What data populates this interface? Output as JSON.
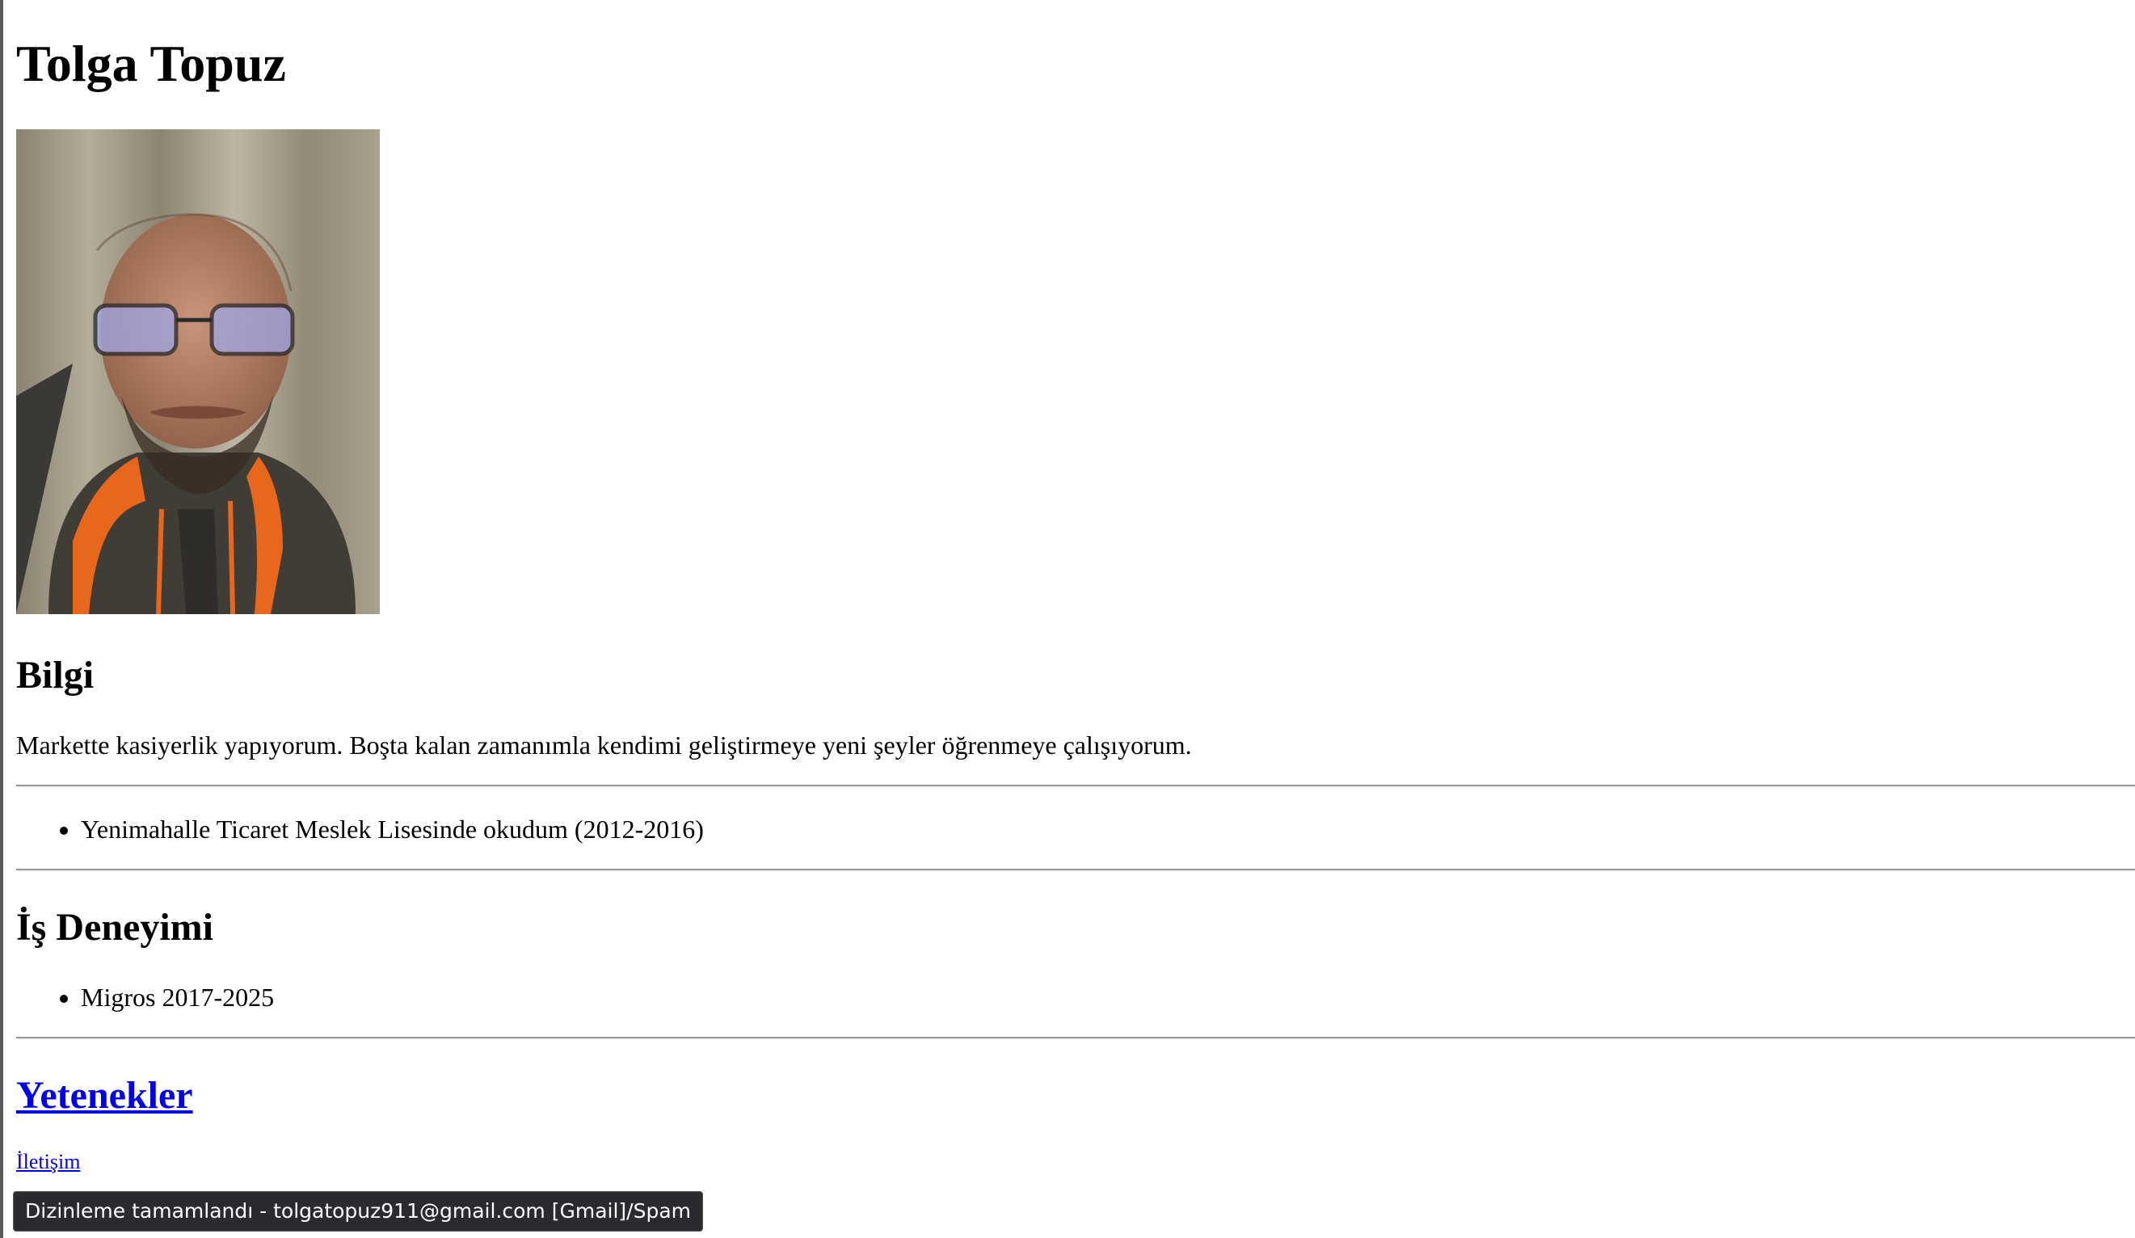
{
  "header": {
    "name": "Tolga Topuz"
  },
  "profile": {
    "photo_icon": "portrait-photo"
  },
  "about": {
    "heading": "Bilgi",
    "text": "Markette kasiyerlik yapıyorum. Boşta kalan zamanımla kendimi geliştirmeye yeni şeyler öğrenmeye çalışıyorum."
  },
  "education": {
    "items": [
      "Yenimahalle Ticaret Meslek Lisesinde okudum (2012-2016)"
    ]
  },
  "experience": {
    "heading": "İş Deneyimi",
    "items": [
      "Migros 2017-2025"
    ]
  },
  "skills": {
    "heading_link": "Yetenekler"
  },
  "contact": {
    "link": "İletişim"
  },
  "status_tooltip": {
    "text": "Dizinleme tamamlandı - tolgatopuz911@gmail.com [Gmail]/Spam"
  },
  "colors": {
    "link": "#0000ee",
    "tooltip_bg": "#2b2b2f",
    "rule": "#9a9a9a"
  }
}
